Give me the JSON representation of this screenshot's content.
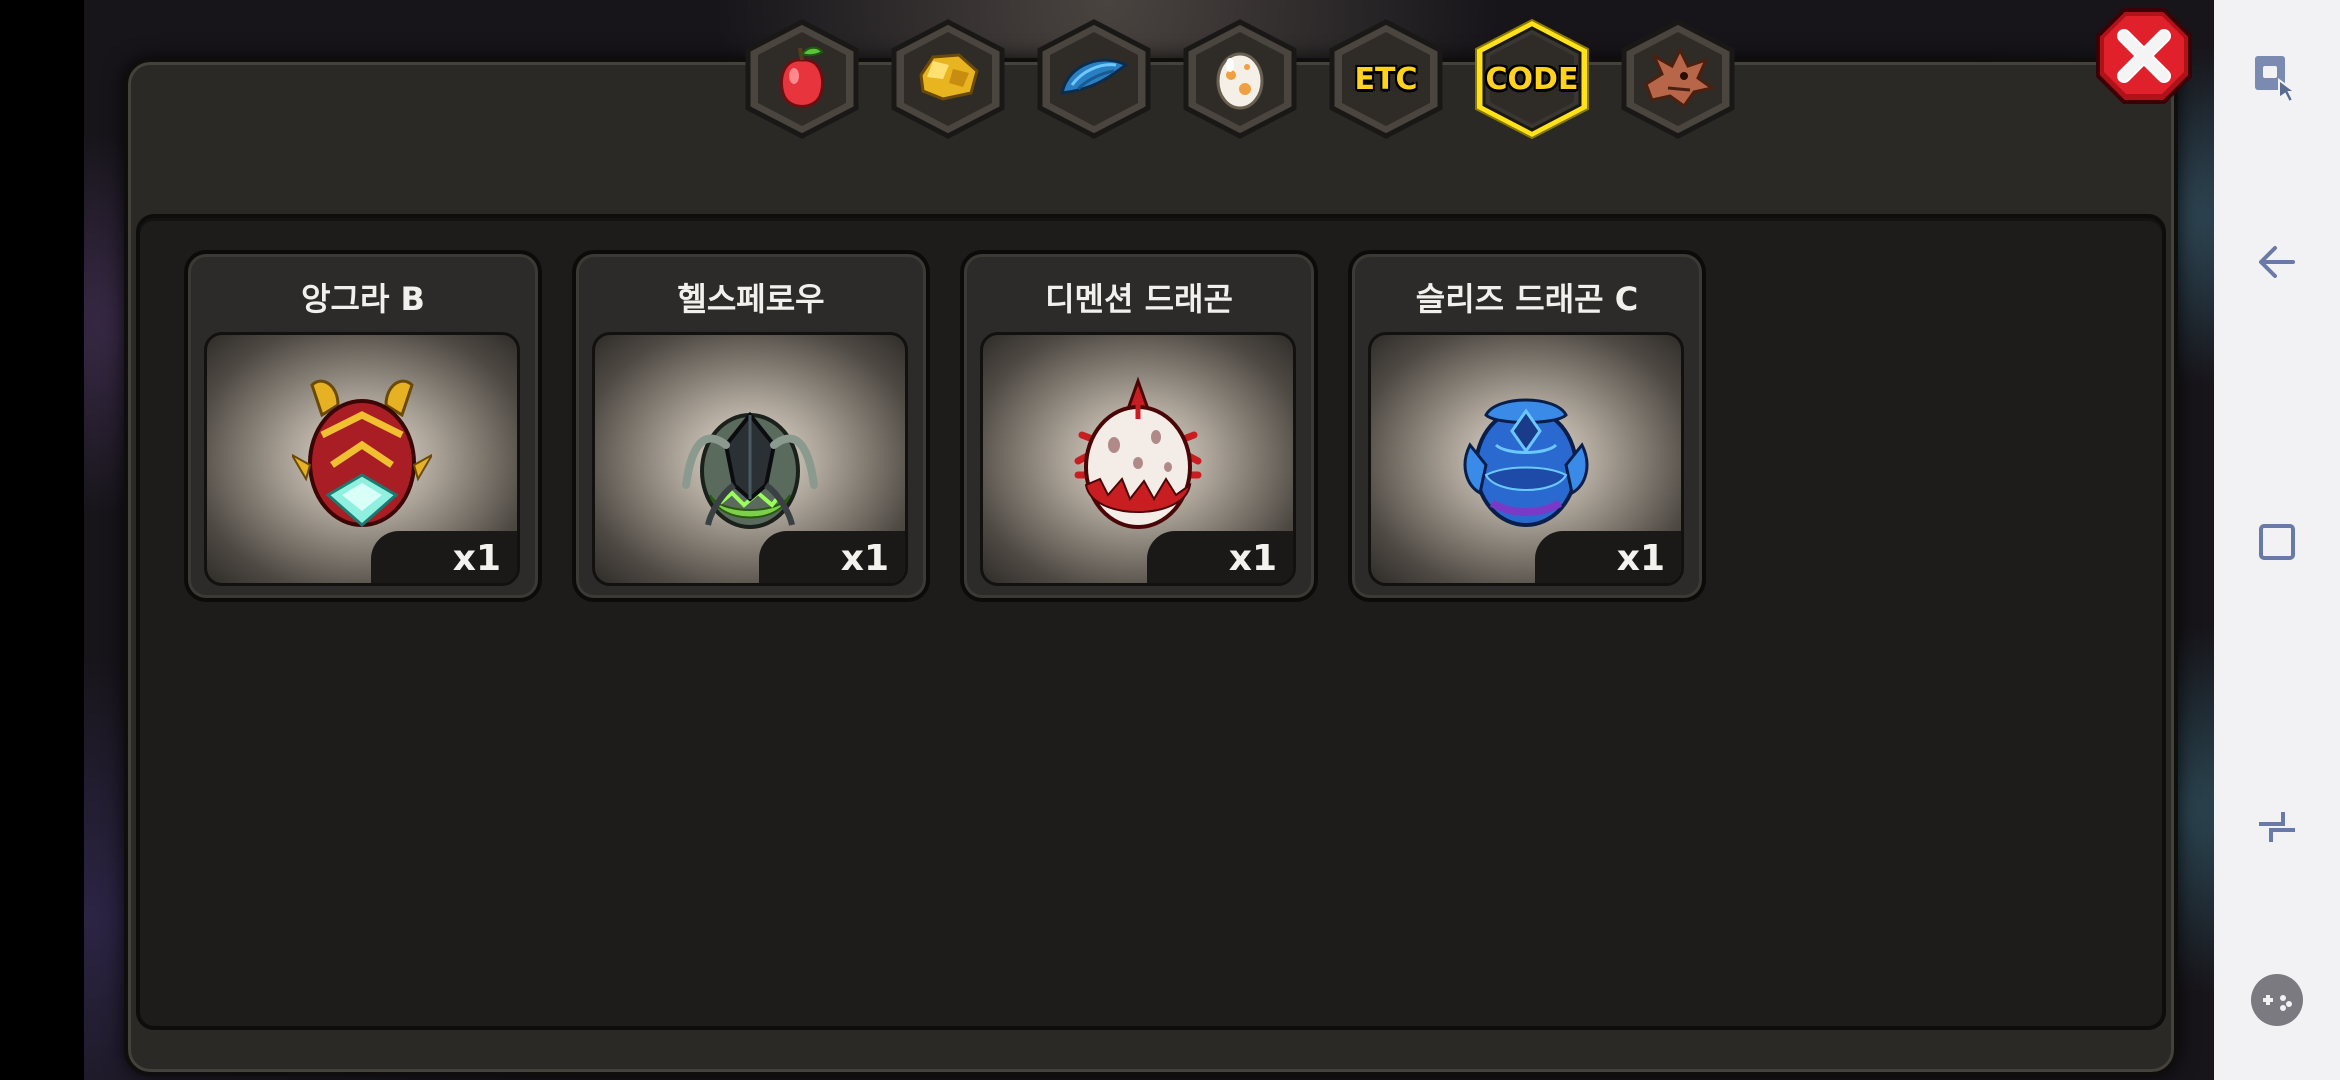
{
  "tabs": [
    {
      "name": "fruit-tab",
      "icon": "fruit-icon",
      "label": ""
    },
    {
      "name": "gold-tab",
      "icon": "gold-ore-icon",
      "label": ""
    },
    {
      "name": "scale-tab",
      "icon": "dragon-scale-icon",
      "label": ""
    },
    {
      "name": "egg-tab",
      "icon": "egg-icon",
      "label": ""
    },
    {
      "name": "etc-tab",
      "icon": "",
      "label": "ETC"
    },
    {
      "name": "code-tab",
      "icon": "",
      "label": "CODE",
      "selected": true
    },
    {
      "name": "dragon-tab",
      "icon": "dragon-head-icon",
      "label": ""
    }
  ],
  "items": [
    {
      "name": "앙그라 B",
      "quantity": "x1",
      "icon": "angra-egg-icon"
    },
    {
      "name": "헬스페로우",
      "quantity": "x1",
      "icon": "hellsparrow-egg-icon"
    },
    {
      "name": "디멘션 드래곤",
      "quantity": "x1",
      "icon": "dimension-dragon-egg-icon"
    },
    {
      "name": "슬리즈 드래곤 C",
      "quantity": "x1",
      "icon": "sleaze-dragon-egg-icon"
    }
  ],
  "colors": {
    "tab_selected_border": "#ffe21a",
    "tab_text": "#ffd21e",
    "close_red": "#e0202a"
  },
  "navbar": {
    "buttons": [
      "screen-lock-icon",
      "back-arrow-icon",
      "recent-apps-icon",
      "rotate-icon",
      "gamepad-icon"
    ]
  }
}
